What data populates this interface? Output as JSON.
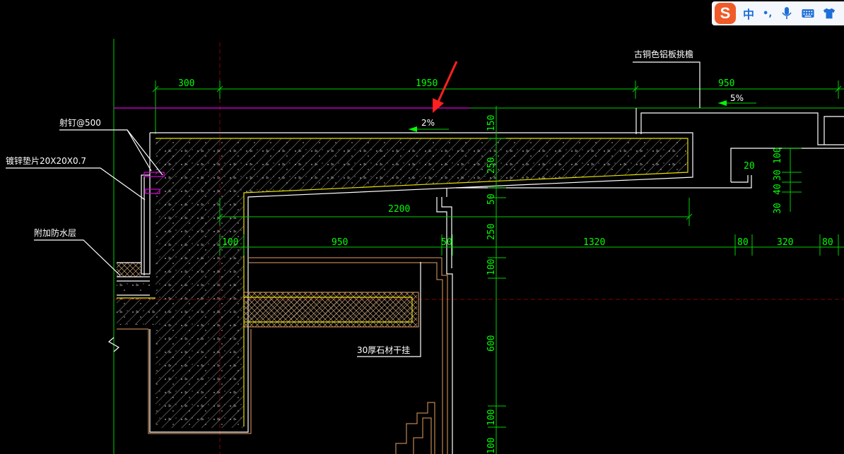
{
  "drawing": {
    "dimensions": {
      "top_300": "300",
      "top_1950": "1950",
      "top_950": "950",
      "span_2200": "2200",
      "row_100": "100",
      "row_950": "950",
      "row_50": "50",
      "row_1320": "1320",
      "row_80a": "80",
      "row_320": "320",
      "row_80b": "80",
      "v_150": "150",
      "v_250a": "250",
      "v_50": "50",
      "v_250b": "250",
      "v_100a": "100",
      "v_600": "600",
      "v_100b": "100",
      "v_100c": "100",
      "r_100": "100",
      "r_30": "30",
      "r_40": "40",
      "r_30b": "30",
      "r_20": "20"
    },
    "slopes": {
      "roof_slope": "2%",
      "gutter_slope": "5%"
    },
    "annotations": {
      "nail": "射钉@500",
      "washer": "镀锌垫片20X20X0.7",
      "waterproof": "附加防水层",
      "stone": "30厚石材干挂",
      "gutter": "古铜色铝板挑檐"
    },
    "colors": {
      "background": "#000000",
      "dimension": "#00ff00",
      "concrete_outline": "#ffffff",
      "finish_line": "#e8e000",
      "parapet_line": "#e000e0",
      "arrow": "#ff2020"
    }
  },
  "ime_toolbar": {
    "logo": "S",
    "mode_label": "中",
    "punct_label": "•,",
    "icons": [
      "microphone-icon",
      "keyboard-icon",
      "shirt-icon"
    ]
  }
}
